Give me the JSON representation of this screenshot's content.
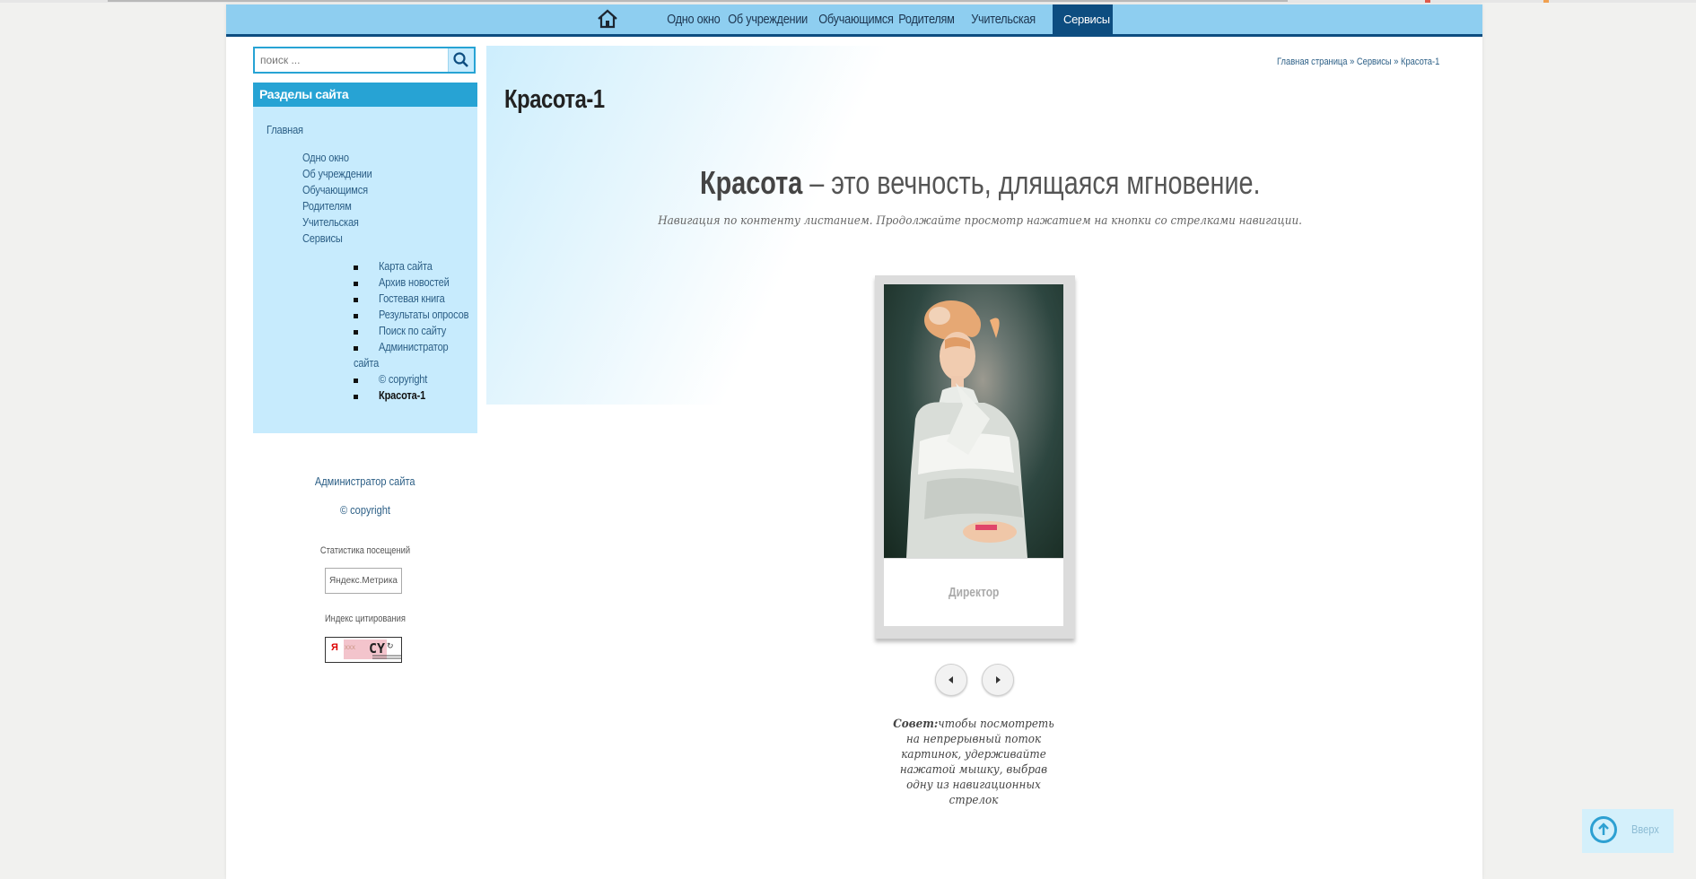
{
  "nav": {
    "home_icon": "home-icon",
    "items": [
      {
        "label": "Одно окно",
        "active": false
      },
      {
        "label": "Об учреждении",
        "active": false
      },
      {
        "label": "Обучающимся",
        "active": false
      },
      {
        "label": "Родителям",
        "active": false
      },
      {
        "label": "Учительская",
        "active": false
      },
      {
        "label": "Сервисы",
        "active": true
      }
    ]
  },
  "search": {
    "placeholder": "поиск ...",
    "button_icon": "search-icon"
  },
  "sections": {
    "title": "Разделы сайта",
    "home": "Главная",
    "level1": [
      "Одно окно",
      "Об учреждении",
      "Обучающимся",
      "Родителям",
      "Учительская",
      "Сервисы"
    ],
    "level2": [
      "Карта сайта",
      "Архив новостей",
      "Гостевая книга",
      "Результаты опросов",
      "Поиск по сайту",
      "Администратор",
      "сайта",
      "© copyright",
      "Красота-1"
    ]
  },
  "footer": {
    "admin": "Администратор сайта",
    "copyright": "© copyright",
    "stats_label": "Статистика посещений",
    "metrika_alt": "Яндекс.Метрика",
    "citation_label": "Индекс цитирования",
    "cy_text": "CY"
  },
  "breadcrumb": "Главная страница » Сервисы » Красота-1",
  "page_title": "Красота-1",
  "quote": {
    "bold": "Красота",
    "rest": " – это вечность, длящаяся мгновение."
  },
  "subnote": "Навигация по контенту листанием. Продолжайте просмотр нажатием на кнопки со стрелками навигации.",
  "slide": {
    "caption": "Директор"
  },
  "tip": {
    "bold": "Совет:",
    "text": "чтобы посмотреть на непрерывный поток картинок, удерживайте нажатой мышку, выбрав одну из навигационных стрелок"
  },
  "to_top": {
    "label": "Вверх",
    "icon": "arrow-up-circle-icon"
  },
  "colors": {
    "nav_bg": "#8ecef0",
    "nav_active": "#0d4d80",
    "sidebar_bg": "#c7ebfd",
    "sidebar_head": "#27a3d4",
    "link": "#2c5f86"
  }
}
